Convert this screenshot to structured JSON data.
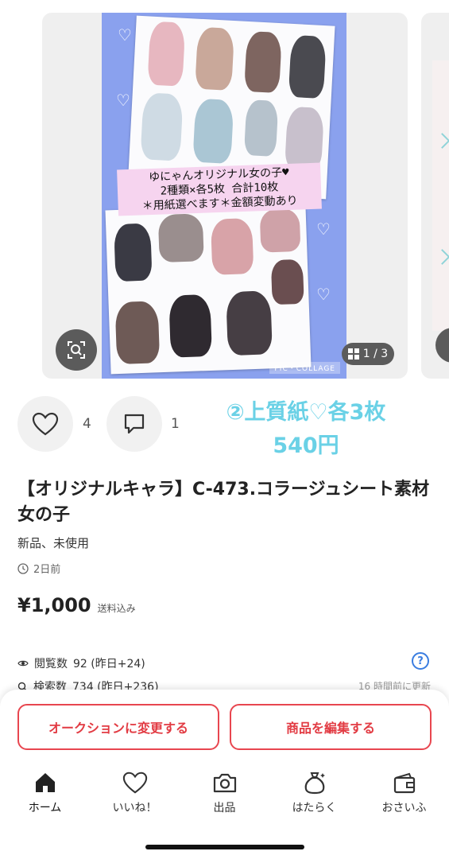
{
  "gallery": {
    "counter": "1 / 3",
    "image_banner_lines": [
      "ゆにゃんオリジナル女の子♥",
      "2種類×各5枚 合計10枚",
      "＊用紙選べます＊金額変動あり"
    ],
    "watermark": "PIC・COLLAGE",
    "zoom_icon": "search-zoom-icon",
    "grid_icon": "grid-icon"
  },
  "actions": {
    "like_count": "4",
    "comment_count": "1"
  },
  "promo": {
    "line1": "②上質紙♡各3枚",
    "line2": "540円"
  },
  "item": {
    "title": "【オリジナルキャラ】C-473.コラージュシート素材　女の子",
    "condition": "新品、未使用",
    "posted": "2日前",
    "price": "¥1,000",
    "shipping": "送料込み"
  },
  "stats": {
    "views_label": "閲覧数",
    "views_value": "92 (昨日+24)",
    "search_label": "検索数",
    "search_value": "734 (昨日+236)",
    "updated": "16 時間前に更新",
    "help": "?"
  },
  "buttons": {
    "auction": "オークションに変更する",
    "edit": "商品を編集する"
  },
  "nav": [
    {
      "label": "ホーム",
      "icon": "home-icon"
    },
    {
      "label": "いいね！",
      "icon": "heart-icon"
    },
    {
      "label": "出品",
      "icon": "camera-icon"
    },
    {
      "label": "はたらく",
      "icon": "money-bag-icon"
    },
    {
      "label": "おさいふ",
      "icon": "wallet-icon"
    }
  ],
  "colors": {
    "accent_red": "#e23b43",
    "promo_cyan": "#6ad1e6",
    "photo_bg": "#8aa1ee",
    "help_blue": "#3a7de0"
  }
}
